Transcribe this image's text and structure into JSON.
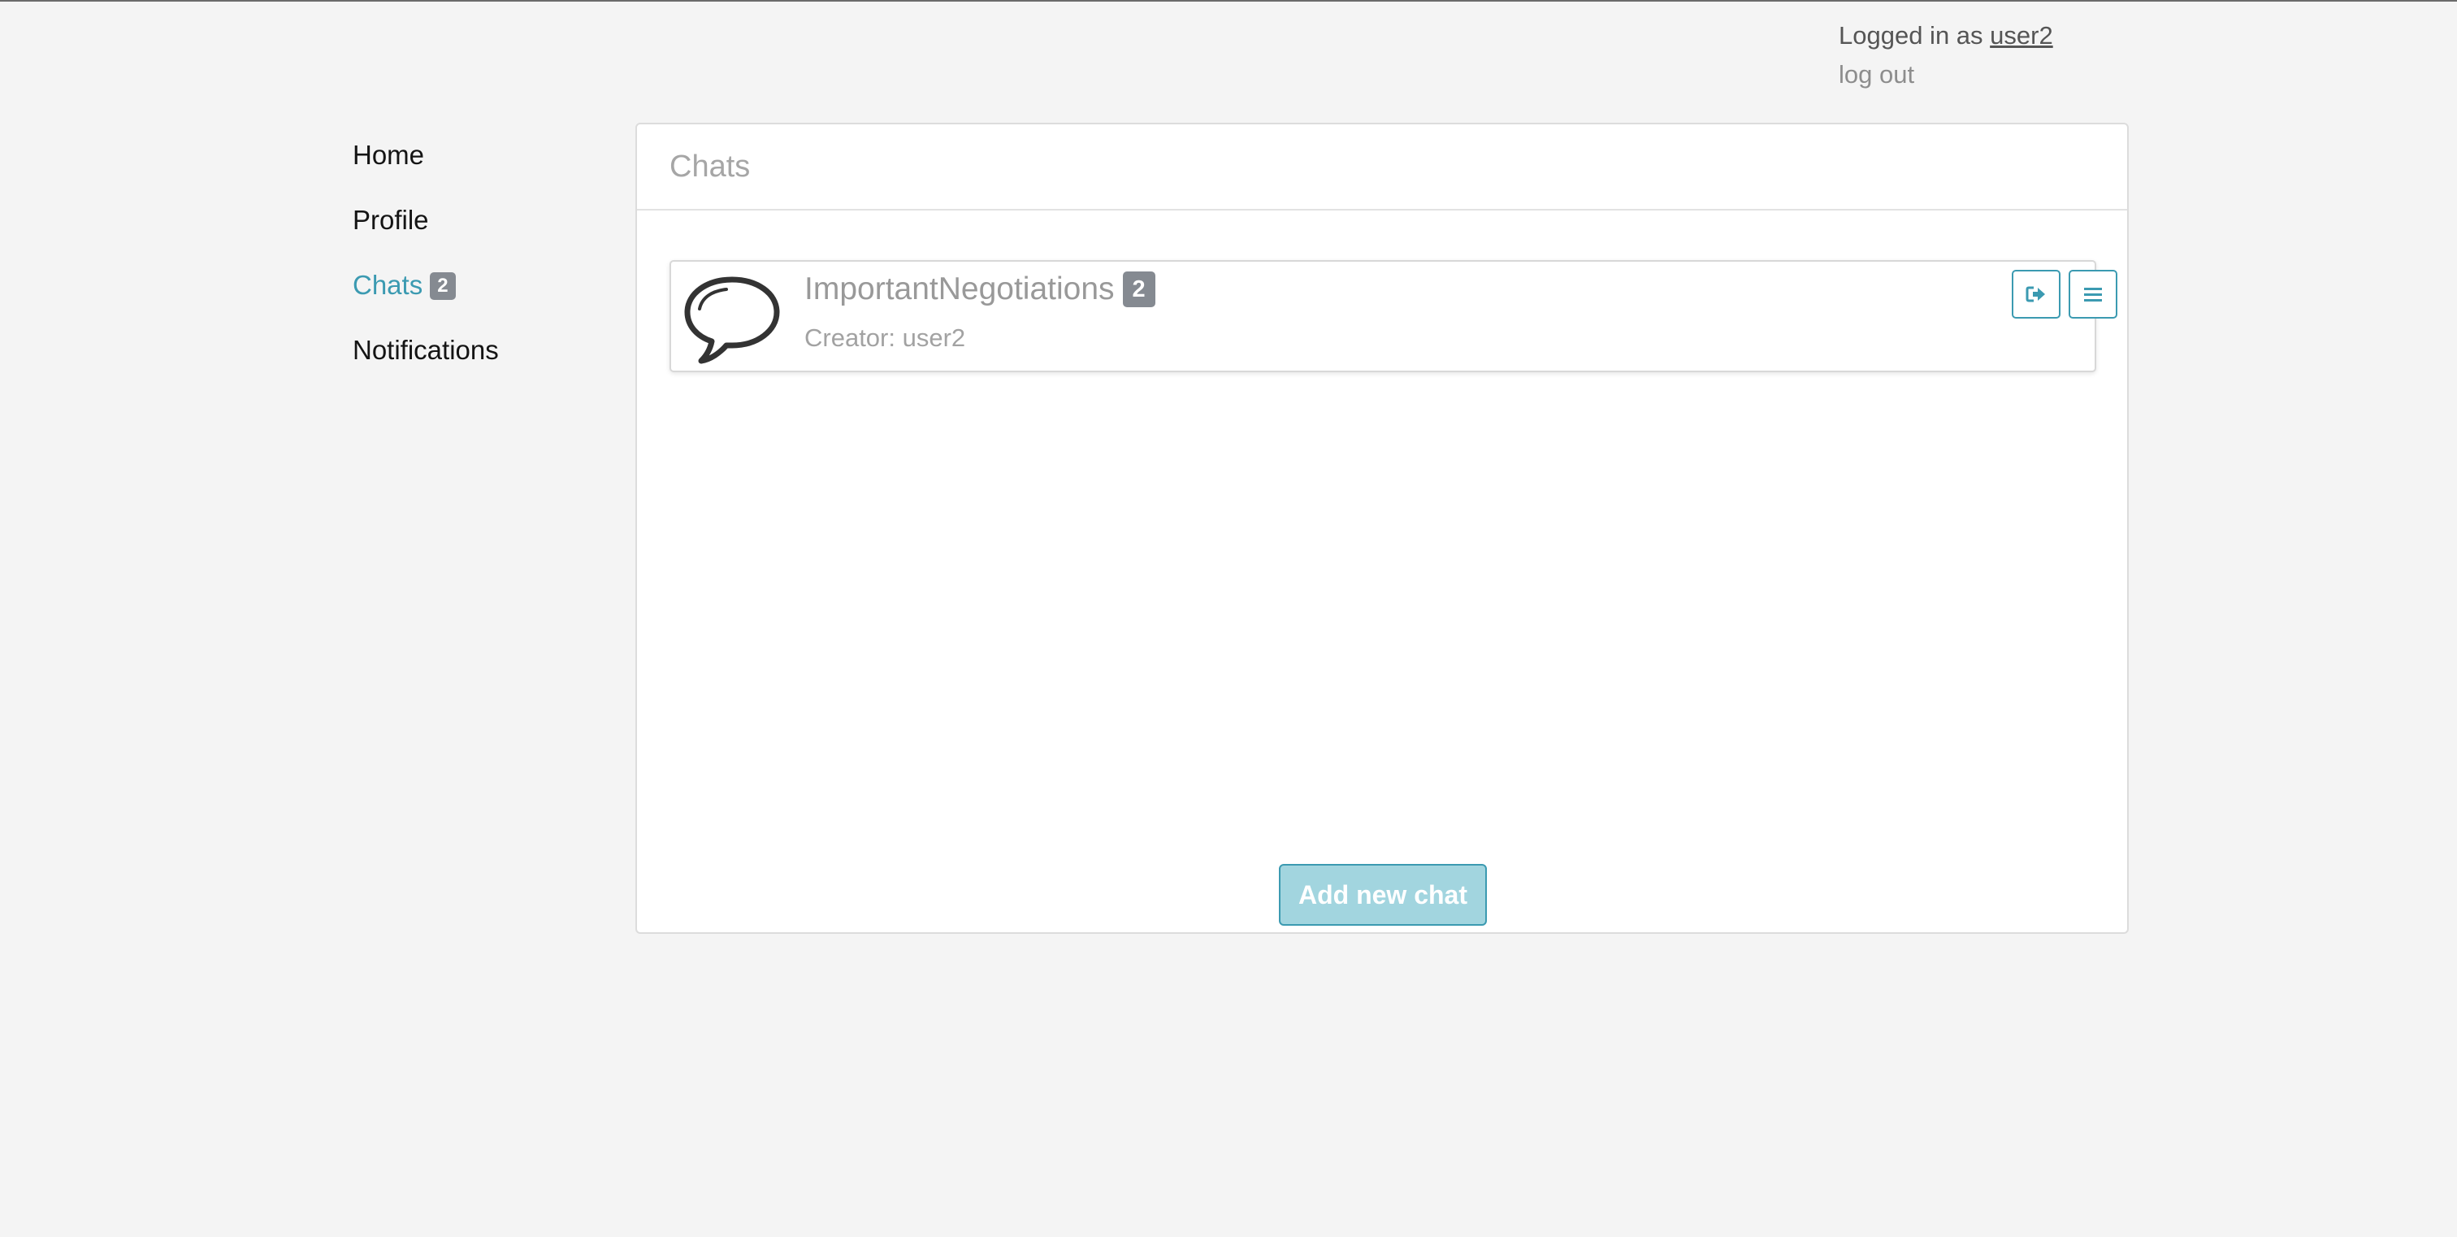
{
  "header": {
    "logged_in_prefix": "Logged in as ",
    "username": "user2",
    "logout_label": "log out"
  },
  "nav": {
    "items": [
      {
        "label": "Home",
        "active": false
      },
      {
        "label": "Profile",
        "active": false
      },
      {
        "label": "Chats",
        "active": true,
        "badge": "2"
      },
      {
        "label": "Notifications",
        "active": false
      }
    ]
  },
  "panel": {
    "title": "Chats"
  },
  "chats": [
    {
      "name": "ImportantNegotiations",
      "badge": "2",
      "creator": "Creator: user2",
      "icon": "speech-bubble-icon",
      "actions": [
        "sign-out-icon",
        "menu-icon"
      ]
    }
  ],
  "add_chat_label": "Add new chat",
  "colors": {
    "accent": "#3b9ab1",
    "badge": "#858a91",
    "background": "#f4f4f4",
    "add_button_fill": "#a2d5df"
  }
}
